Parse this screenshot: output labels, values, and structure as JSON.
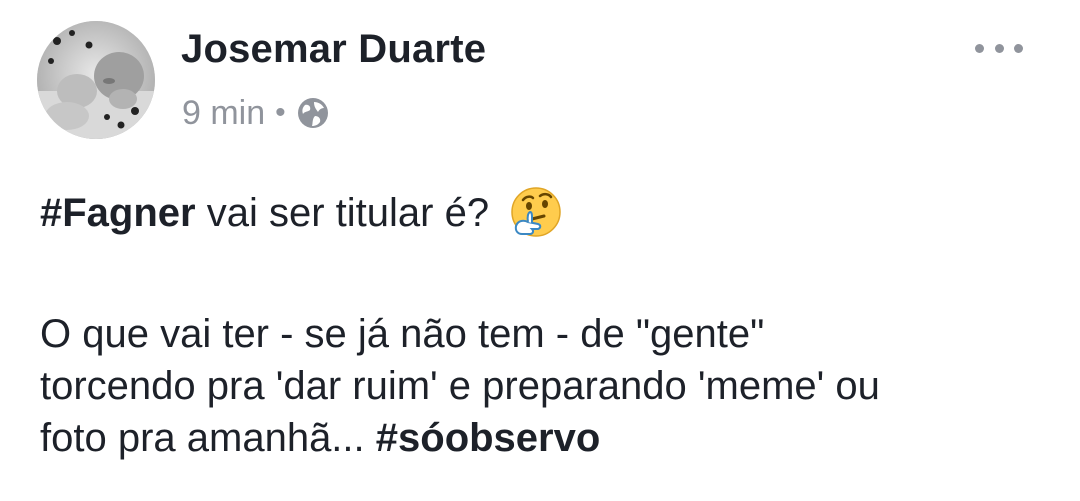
{
  "post": {
    "author": "Josemar Duarte",
    "time": "9 min",
    "separator": "•",
    "privacy_icon": "globe-icon",
    "more_icon": "more-options-icon",
    "line1": {
      "hashtag": "#Fagner",
      "text": " vai ser titular é?",
      "emoji": "thinking-face-icon"
    },
    "para2": {
      "line1": "O que vai ter - se já não tem - de \"gente\"",
      "line2": "torcendo pra 'dar ruim' e preparando 'meme' ou",
      "line3_text": "foto pra amanhã... ",
      "line3_hashtag": "#sóobservo"
    }
  },
  "colors": {
    "text": "#1d2129",
    "meta": "#90949c",
    "emoji_face": "#ffcc4d"
  }
}
